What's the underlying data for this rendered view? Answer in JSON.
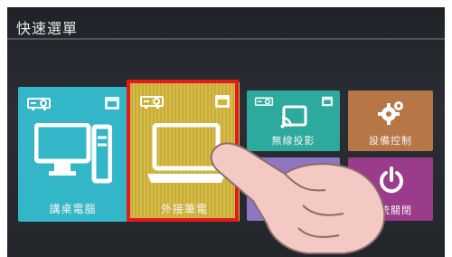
{
  "header": {
    "title": "快速選單"
  },
  "tiles": {
    "desktop": {
      "label": "講桌電腦"
    },
    "laptop": {
      "label": "外接筆電"
    },
    "wireless": {
      "label": "無線投影"
    },
    "settings": {
      "label": "設備控制"
    },
    "purple": {
      "label": ""
    },
    "power": {
      "label": "系統關閉"
    }
  },
  "colors": {
    "desktop": "#34b6c9",
    "laptop": "#d3b53b",
    "wireless": "#2ea99d",
    "settings": "#b77645",
    "purple": "#8f76c3",
    "power": "#9b3b8b",
    "focus": "#e11b1b"
  },
  "icons": {
    "desktop": [
      "projector-icon",
      "doc-icon",
      "desktop-computer-icon"
    ],
    "laptop": [
      "projector-icon",
      "doc-icon",
      "laptop-icon"
    ],
    "wireless": [
      "projector-icon",
      "doc-icon",
      "cast-icon"
    ],
    "settings": [
      "gear-icon"
    ],
    "power": [
      "power-icon"
    ],
    "overlay": [
      "pointing-hand-icon"
    ]
  }
}
